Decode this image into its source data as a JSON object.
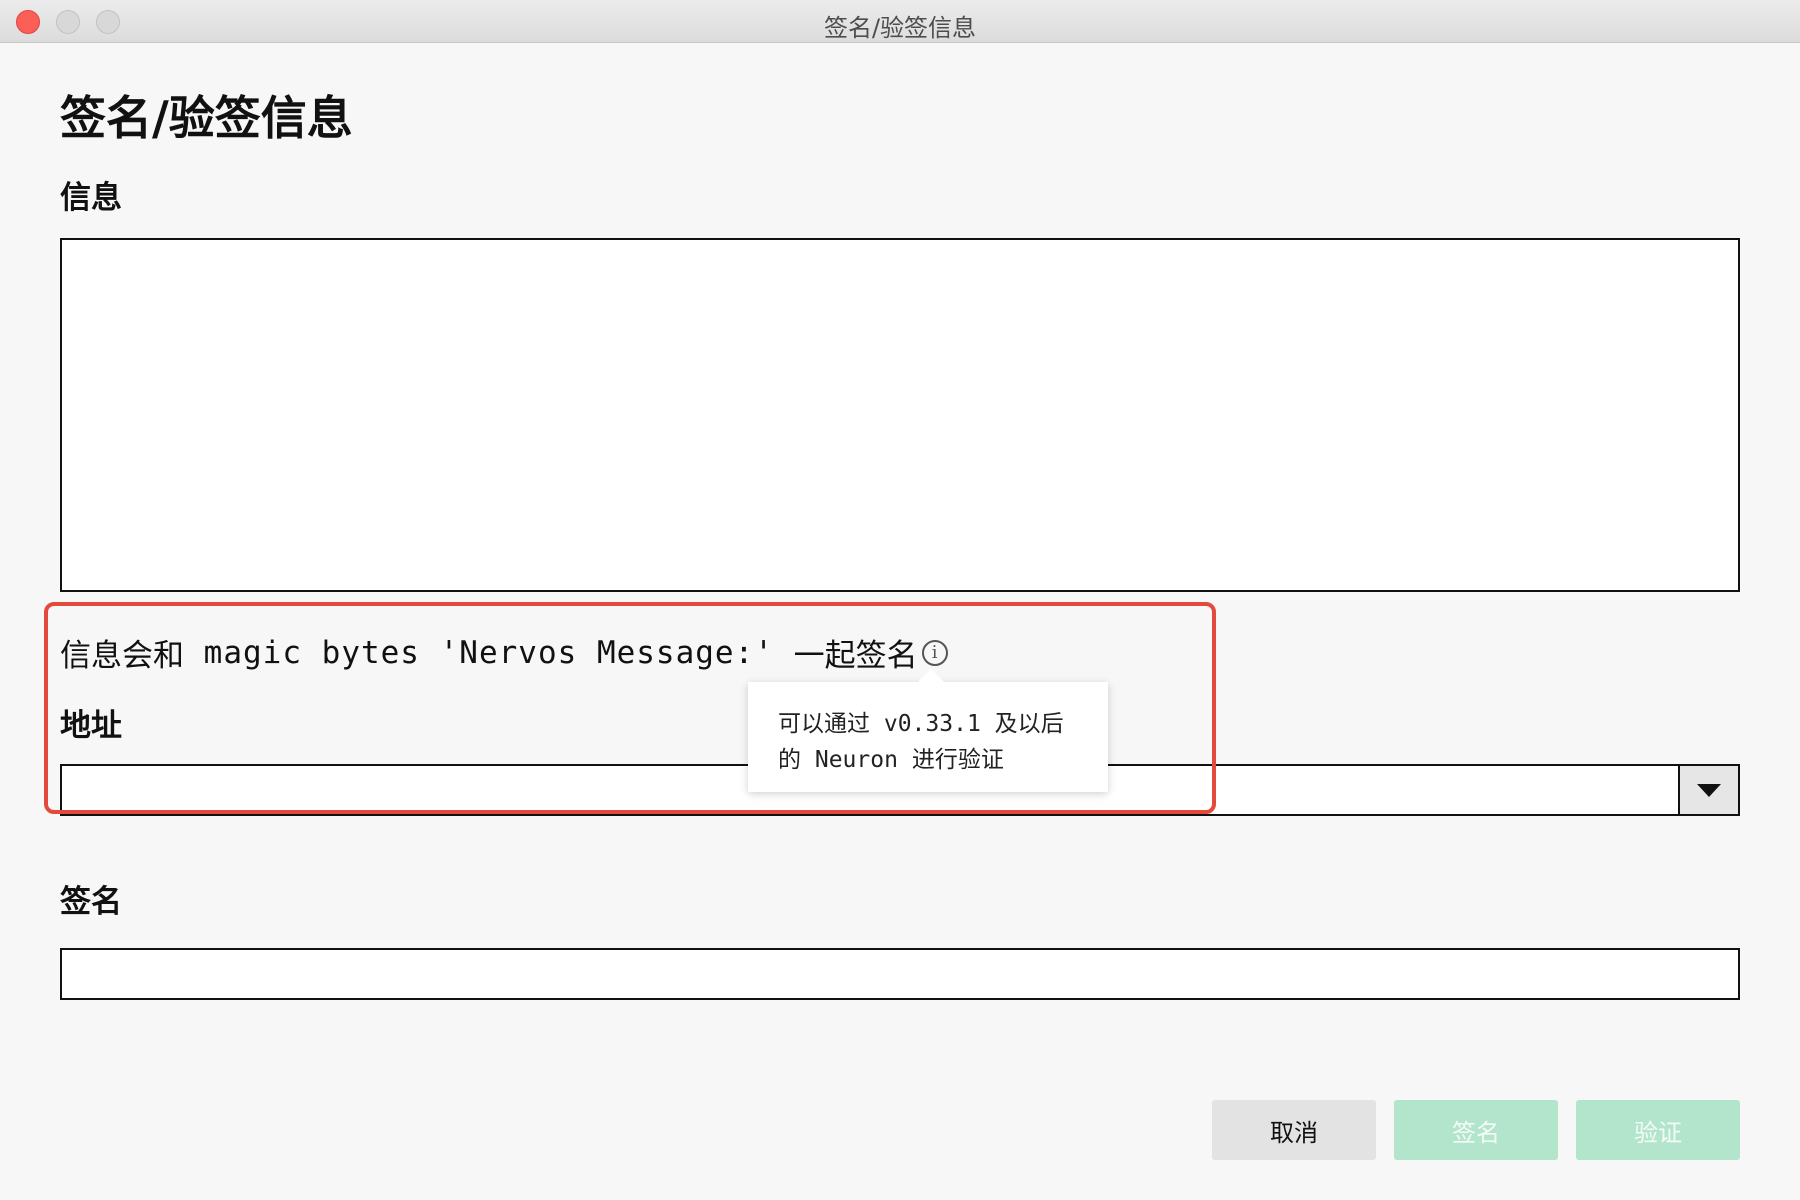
{
  "window": {
    "title": "签名/验签信息"
  },
  "page": {
    "title": "签名/验签信息"
  },
  "message": {
    "label": "信息",
    "value": "",
    "hint_prefix": "信息会和",
    "hint_code": "magic bytes 'Nervos Message:'",
    "hint_suffix": "一起签名",
    "info_icon": "info-icon"
  },
  "tooltip": {
    "line1_prefix": "可以通过",
    "line1_code": "v0.33.1",
    "line1_suffix": "及以后",
    "line2_prefix": "的",
    "line2_code": "Neuron",
    "line2_suffix": "进行验证"
  },
  "address": {
    "label": "地址",
    "value": ""
  },
  "signature": {
    "label": "签名",
    "value": ""
  },
  "buttons": {
    "cancel": "取消",
    "sign": "签名",
    "verify": "验证"
  },
  "colors": {
    "highlight": "#e34a3b",
    "primary_disabled": "#b3e5cc",
    "cancel_bg": "#e3e3e3"
  }
}
